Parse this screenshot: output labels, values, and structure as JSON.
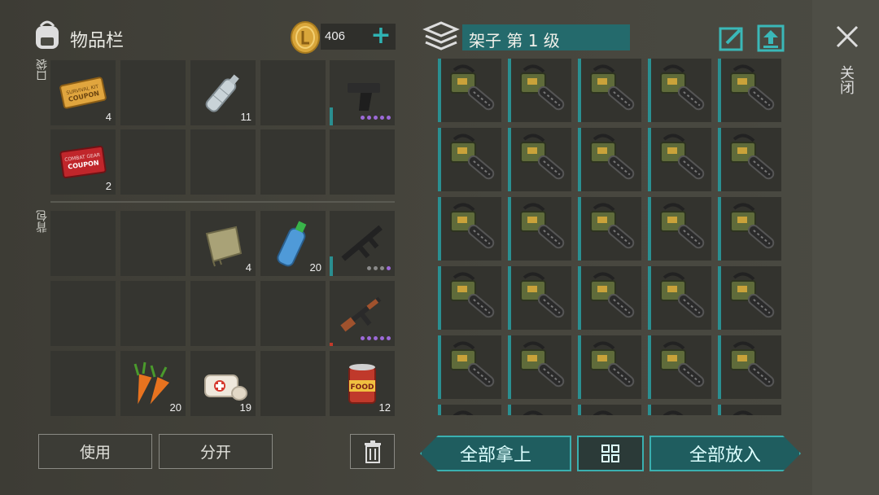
{
  "inventory": {
    "title": "物品栏",
    "coins": "406",
    "plus_label": "+",
    "pocket_label": "口袋",
    "backpack_label": "背包",
    "pocket_items": [
      {
        "name": "survival-kit-coupon",
        "count": "4",
        "coupon_text": "SURVIVAL KIT COUPON"
      },
      {
        "name": "empty",
        "count": ""
      },
      {
        "name": "plastic-bottle",
        "count": "11"
      },
      {
        "name": "empty",
        "count": ""
      },
      {
        "name": "pistol",
        "count": ""
      },
      {
        "name": "combat-gear-coupon",
        "count": "2",
        "coupon_text": "COMBAT GEAR COUPON"
      }
    ],
    "backpack_counts": {
      "cloth": "4",
      "water": "20",
      "carrot": "20",
      "bandage": "19",
      "food_can": "12"
    },
    "food_label": "FOOD",
    "use_button": "使用",
    "split_button": "分开"
  },
  "storage": {
    "title": "架子 第 1 级",
    "item_name": "chainsaw",
    "rows": 5,
    "cols": 5,
    "take_all": "全部拿上",
    "put_all": "全部放入"
  },
  "close_label": "关闭",
  "colors": {
    "accent": "#2a8f91",
    "purple": "#9c6ad8",
    "coin": "#d9a63a"
  }
}
